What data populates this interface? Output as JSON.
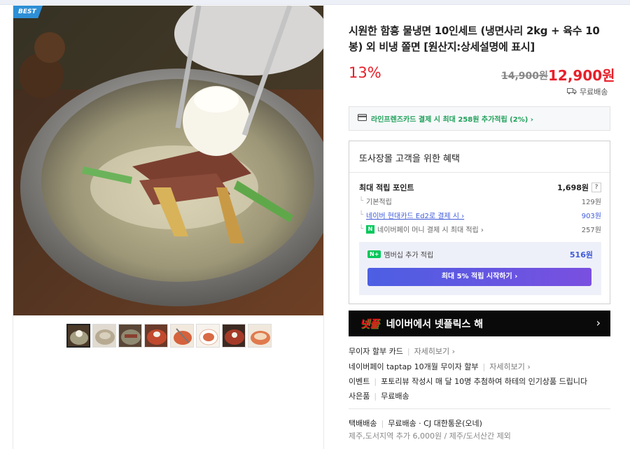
{
  "badge": "BEST",
  "product": {
    "title": "시원한 함흥 물냉면 10인세트 (냉면사리 2kg + 육수 10봉) 외 비냉 쫄면 [원산지:상세설명에 표시]",
    "discount": "13%",
    "original_price": "14,900원",
    "sale_price": "12,900원",
    "shipping": "무료배송"
  },
  "card_promo": "라인프렌즈카드 결제 시 최대 258원 추가적립 (2%) ›",
  "benefits": {
    "title": "또사장몰 고객을 위한 혜택",
    "max_points_label": "최대 적립 포인트",
    "max_points_value": "1,698원",
    "help": "?",
    "rows": [
      {
        "label": "기본적립",
        "value": "129원"
      },
      {
        "label": "네이버 현대카드 Ed2로 결제 시 ›",
        "value": "903원"
      },
      {
        "label": "네이버페이 머니 결제 시 최대 적립 ›",
        "value": "257원"
      }
    ],
    "npay_mark": "N",
    "membership_mark": "N+",
    "membership_label": "멤버십 추가 적립",
    "membership_value": "516원",
    "membership_button": "최대 5% 적립 시작하기 ›"
  },
  "netflix_banner": {
    "logo": "넷플",
    "text": "네이버에서 넷플릭스 해",
    "arrow": "›"
  },
  "info": {
    "installment_label": "무이자 할부 카드",
    "installment_more": "자세히보기 ›",
    "npay_installment_label": "네이버페이 taptap 10개월 무이자 할부",
    "npay_installment_more": "자세히보기 ›",
    "event_label": "이벤트",
    "event_text": "포토리뷰 작성시 매 달 10명 추첨하여 하테의 인기상품 드립니다",
    "gift_label": "사은품",
    "gift_text": "무료배송",
    "delivery_label": "택배배송",
    "delivery_text": "무료배송 · CJ 대한통운(오네)",
    "delivery_sub": "제주,도서지역 추가 6,000원 / 제주/도서산간 제외"
  },
  "colors": {
    "price_red": "#e7202a",
    "point_blue": "#3f5ad9",
    "npay_green": "#03c75a",
    "badge_blue": "#2e8fd6"
  },
  "icons": [
    "truck-icon",
    "card-icon",
    "question-icon",
    "chevron-right-icon"
  ]
}
